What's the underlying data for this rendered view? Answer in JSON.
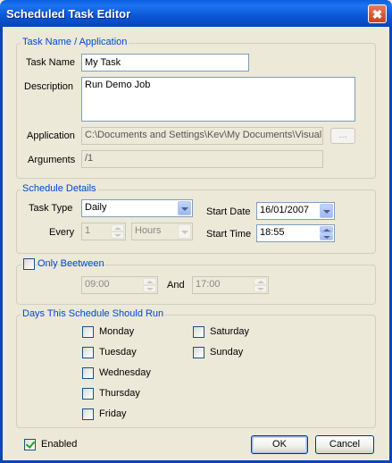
{
  "window": {
    "title": "Scheduled Task Editor",
    "close_glyph": "✖"
  },
  "task": {
    "legend": "Task Name / Application",
    "name_label": "Task Name",
    "name_value": "My Task",
    "description_label": "Description",
    "description_value": "Run Demo Job",
    "application_label": "Application",
    "application_value": "C:\\Documents and Settings\\Kev\\My Documents\\Visual",
    "browse_label": "...",
    "arguments_label": "Arguments",
    "arguments_value": "/1"
  },
  "schedule": {
    "legend": "Schedule Details",
    "task_type_label": "Task Type",
    "task_type_value": "Daily",
    "every_label": "Every",
    "every_value": "1",
    "every_unit": "Hours",
    "start_date_label": "Start Date",
    "start_date_value": "16/01/2007",
    "start_time_label": "Start Time",
    "start_time_value": "18:55"
  },
  "only_between": {
    "label": "Only Beetween",
    "checked": false,
    "from_value": "09:00",
    "and_label": "And",
    "to_value": "17:00"
  },
  "days": {
    "legend": "Days This Schedule Should Run",
    "items": [
      "Monday",
      "Tuesday",
      "Wednesday",
      "Thursday",
      "Friday",
      "Saturday",
      "Sunday"
    ]
  },
  "footer": {
    "enabled_label": "Enabled",
    "enabled_checked": true,
    "ok_label": "OK",
    "cancel_label": "Cancel"
  },
  "colors": {
    "title_bar": "#0A57D8",
    "group_label": "#0046D5",
    "dialog_bg": "#ECE9D8"
  }
}
